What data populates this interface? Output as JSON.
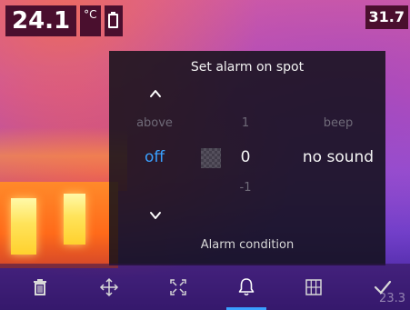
{
  "status": {
    "spot_temperature": "24.1",
    "unit": "°C",
    "battery_icon": "battery-icon"
  },
  "scale": {
    "max": "31.7",
    "min": "23.3"
  },
  "dialog": {
    "title": "Set alarm on spot",
    "footer": "Alarm condition",
    "columns": {
      "condition": {
        "above": "above",
        "selected": "off"
      },
      "value": {
        "above": "1",
        "selected": "0",
        "below": "-1"
      },
      "sound": {
        "above": "beep",
        "selected": "no sound"
      }
    },
    "selected_color": "#3aa0ff"
  },
  "toolbar": {
    "buttons": [
      {
        "icon": "trash-icon"
      },
      {
        "icon": "move-icon"
      },
      {
        "icon": "resize-icon"
      },
      {
        "icon": "bell-icon",
        "active": true
      },
      {
        "icon": "grid-icon"
      },
      {
        "icon": "checkmark-icon"
      }
    ]
  }
}
